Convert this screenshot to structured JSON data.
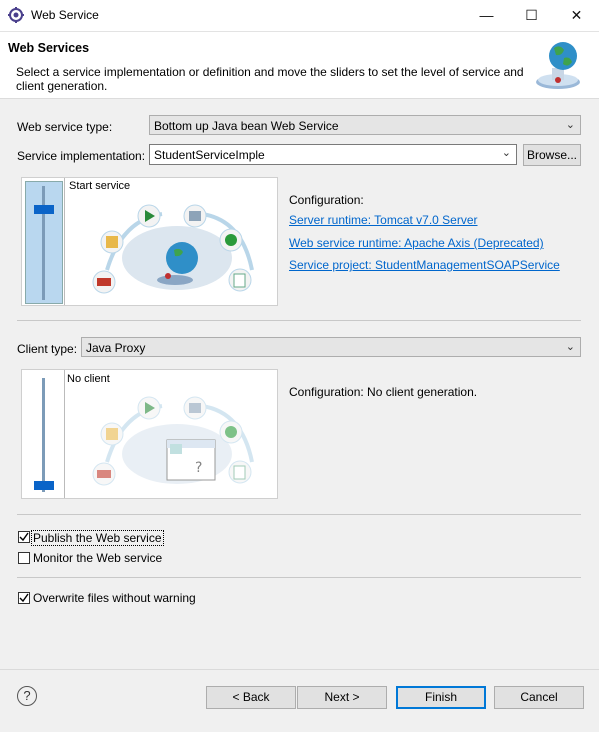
{
  "window": {
    "title": "Web Service"
  },
  "header": {
    "title": "Web Services",
    "description": "Select a service implementation or definition and move the sliders to set the level of service and client generation."
  },
  "service": {
    "type_label": "Web service type:",
    "type_value": "Bottom up Java bean Web Service",
    "impl_label": "Service implementation:",
    "impl_value": "StudentServiceImple",
    "browse_label": "Browse...",
    "slider_level_label": "Start service",
    "config_title": "Configuration:",
    "server_runtime": "Server runtime: Tomcat v7.0 Server",
    "ws_runtime": "Web service runtime: Apache Axis (Deprecated)",
    "service_project": "Service project: StudentManagementSOAPService"
  },
  "client": {
    "type_label": "Client type:",
    "type_value": "Java Proxy",
    "slider_level_label": "No client",
    "config_text": "Configuration: No client generation."
  },
  "options": {
    "publish": {
      "label": "Publish the Web service",
      "checked": true
    },
    "monitor": {
      "label": "Monitor the Web service",
      "checked": false
    },
    "overwrite": {
      "label": "Overwrite files without warning",
      "checked": true
    }
  },
  "footer": {
    "help": "?",
    "back": "< Back",
    "next": "Next >",
    "finish": "Finish",
    "cancel": "Cancel"
  },
  "colors": {
    "accent": "#0066cc",
    "slider_thumb": "#0a64c8",
    "track_fill": "#b9d7ef"
  }
}
